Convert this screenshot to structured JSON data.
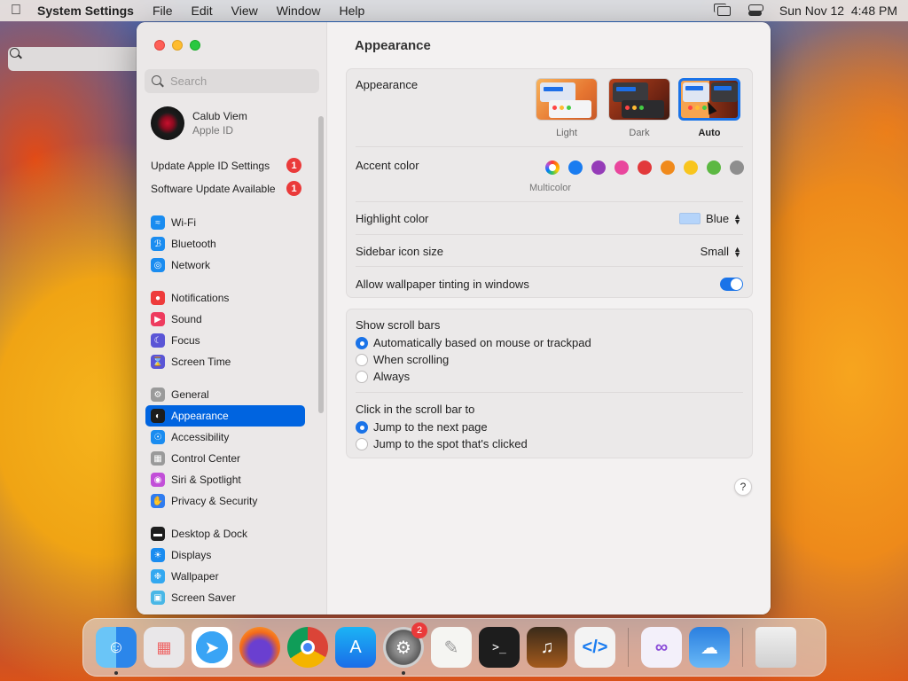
{
  "menubar": {
    "app_name": "System Settings",
    "items": [
      "File",
      "Edit",
      "View",
      "Window",
      "Help"
    ],
    "clock": "Sun Nov 12  4:48 PM"
  },
  "sidebar": {
    "search_placeholder": "Search",
    "account": {
      "name": "Calub Viem",
      "subtitle": "Apple ID"
    },
    "notices": [
      {
        "label": "Update Apple ID Settings",
        "badge": "1"
      },
      {
        "label": "Software Update Available",
        "badge": "1"
      }
    ],
    "groups": [
      [
        {
          "label": "Wi-Fi",
          "icon": "wifi-icon",
          "color": "#1a8cf0"
        },
        {
          "label": "Bluetooth",
          "icon": "bluetooth-icon",
          "color": "#1a8cf0"
        },
        {
          "label": "Network",
          "icon": "globe-icon",
          "color": "#1a8cf0"
        }
      ],
      [
        {
          "label": "Notifications",
          "icon": "bell-icon",
          "color": "#ee3b3b"
        },
        {
          "label": "Sound",
          "icon": "speaker-icon",
          "color": "#ee3b5e"
        },
        {
          "label": "Focus",
          "icon": "moon-icon",
          "color": "#5a55d6"
        },
        {
          "label": "Screen Time",
          "icon": "hourglass-icon",
          "color": "#5a55d6"
        }
      ],
      [
        {
          "label": "General",
          "icon": "gear-icon",
          "color": "#9a9a9a"
        },
        {
          "label": "Appearance",
          "icon": "appearance-icon",
          "color": "#1d1d1d",
          "active": true
        },
        {
          "label": "Accessibility",
          "icon": "accessibility-icon",
          "color": "#1a8cf0"
        },
        {
          "label": "Control Center",
          "icon": "control-center-icon",
          "color": "#9a9a9a"
        },
        {
          "label": "Siri & Spotlight",
          "icon": "siri-icon",
          "color": "#c24fd8"
        },
        {
          "label": "Privacy & Security",
          "icon": "hand-icon",
          "color": "#2f7cf0"
        }
      ],
      [
        {
          "label": "Desktop & Dock",
          "icon": "dock-icon",
          "color": "#1d1d1d"
        },
        {
          "label": "Displays",
          "icon": "display-icon",
          "color": "#1a8cf0"
        },
        {
          "label": "Wallpaper",
          "icon": "wallpaper-icon",
          "color": "#33a8f0"
        },
        {
          "label": "Screen Saver",
          "icon": "screensaver-icon",
          "color": "#49b7e6"
        }
      ]
    ]
  },
  "main": {
    "title": "Appearance",
    "appearance": {
      "label": "Appearance",
      "options": [
        {
          "label": "Light",
          "selected": false
        },
        {
          "label": "Dark",
          "selected": false
        },
        {
          "label": "Auto",
          "selected": true
        }
      ]
    },
    "accent": {
      "label": "Accent color",
      "selected_label": "Multicolor",
      "colors": [
        "multicolor",
        "#1a7cf0",
        "#953cb8",
        "#e9469d",
        "#e2393b",
        "#f08a1c",
        "#f8c51e",
        "#5cb842",
        "#8e8e8e"
      ]
    },
    "highlight": {
      "label": "Highlight color",
      "value": "Blue"
    },
    "sidebar_icon_size": {
      "label": "Sidebar icon size",
      "value": "Small"
    },
    "wallpaper_tinting": {
      "label": "Allow wallpaper tinting in windows",
      "enabled": true
    },
    "scroll_bars": {
      "label": "Show scroll bars",
      "options": [
        {
          "label": "Automatically based on mouse or trackpad",
          "selected": true
        },
        {
          "label": "When scrolling",
          "selected": false
        },
        {
          "label": "Always",
          "selected": false
        }
      ]
    },
    "click_scroll": {
      "label": "Click in the scroll bar to",
      "options": [
        {
          "label": "Jump to the next page",
          "selected": true
        },
        {
          "label": "Jump to the spot that's clicked",
          "selected": false
        }
      ]
    },
    "help": "?"
  },
  "dock": {
    "apps": [
      {
        "name": "finder-icon",
        "running": true
      },
      {
        "name": "launchpad-icon"
      },
      {
        "name": "safari-icon"
      },
      {
        "name": "firefox-icon"
      },
      {
        "name": "chrome-icon"
      },
      {
        "name": "app-store-icon"
      },
      {
        "name": "system-settings-icon",
        "running": true,
        "badge": "2"
      },
      {
        "name": "textedit-icon"
      },
      {
        "name": "terminal-icon"
      },
      {
        "name": "garageband-icon"
      },
      {
        "name": "vscode-icon"
      }
    ],
    "recent": [
      {
        "name": "visual-studio-icon"
      },
      {
        "name": "weather-icon"
      }
    ],
    "trash": {
      "name": "trash-icon"
    }
  }
}
